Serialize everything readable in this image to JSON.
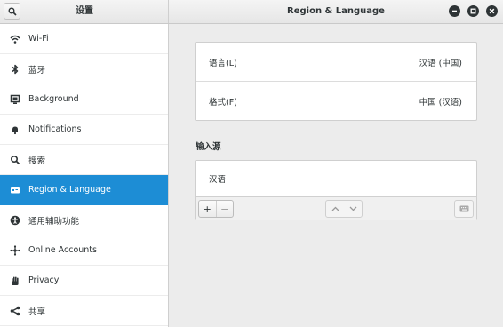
{
  "header": {
    "left_title": "设置",
    "right_title": "Region & Language"
  },
  "sidebar": {
    "items": [
      {
        "label": "Wi-Fi",
        "icon": "wifi-icon"
      },
      {
        "label": "蓝牙",
        "icon": "bluetooth-icon"
      },
      {
        "label": "Background",
        "icon": "background-icon"
      },
      {
        "label": "Notifications",
        "icon": "bell-icon"
      },
      {
        "label": "搜索",
        "icon": "search-icon"
      },
      {
        "label": "Region & Language",
        "icon": "region-icon",
        "active": true
      },
      {
        "label": "通用辅助功能",
        "icon": "accessibility-icon"
      },
      {
        "label": "Online Accounts",
        "icon": "online-accounts-icon"
      },
      {
        "label": "Privacy",
        "icon": "privacy-hand-icon"
      },
      {
        "label": "共享",
        "icon": "share-icon"
      }
    ]
  },
  "main": {
    "language": {
      "label": "语言(L)",
      "value": "汉语 (中国)"
    },
    "formats": {
      "label": "格式(F)",
      "value": "中国 (汉语)"
    },
    "input_sources_title": "输入源",
    "input_sources": [
      "汉语"
    ],
    "toolbar": {
      "add": "+",
      "remove": "−"
    }
  },
  "colors": {
    "accent": "#1d8dd5",
    "sidebar_bg": "#ffffff",
    "content_bg": "#ececec"
  }
}
